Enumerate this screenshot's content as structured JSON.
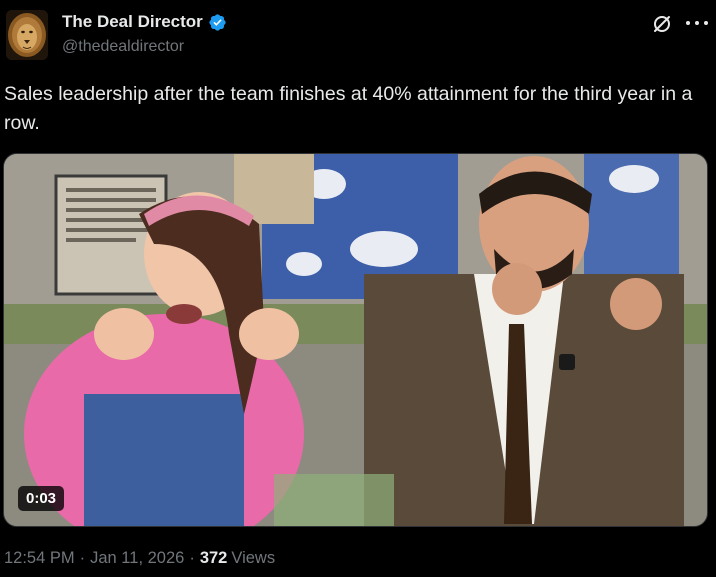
{
  "post": {
    "author": {
      "display_name": "The Deal Director",
      "handle": "@thedealdirector",
      "verified": true,
      "avatar_icon": "lion-avatar"
    },
    "text": "Sales leadership after the team finishes at 40% attainment for the third year in a row.",
    "media": {
      "type": "video",
      "duration_label": "0:03"
    },
    "time": "12:54 PM",
    "date": "Jan 11, 2026",
    "separator": "·",
    "views_count": "372",
    "views_label": "Views"
  },
  "icons": {
    "grok": "grok-slash-icon",
    "more": "more-dots-icon",
    "verified": "verified-badge-icon"
  },
  "colors": {
    "background": "#000000",
    "text_primary": "#e7e9ea",
    "text_secondary": "#71767b",
    "verified_blue": "#1d9bf0"
  }
}
